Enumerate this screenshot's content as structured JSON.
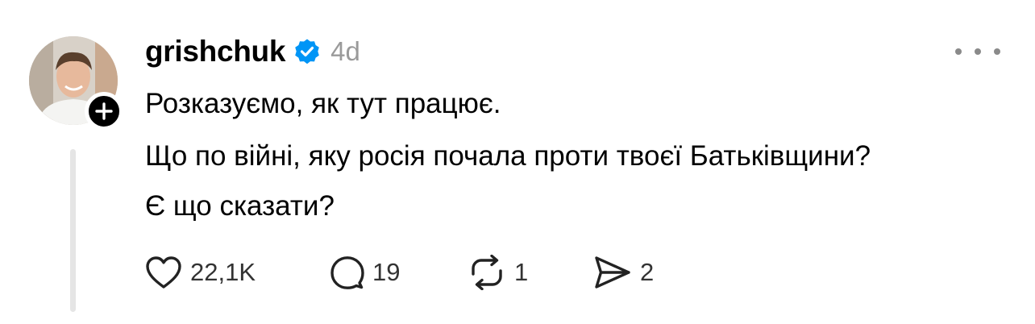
{
  "post": {
    "author": {
      "username": "grishchuk",
      "verified": true,
      "time_ago": "4d"
    },
    "text_lines": [
      "Розказуємо, як тут працює.",
      "Що по війні, яку росія почала проти твоєї Батьківщини?",
      "Є що сказати?"
    ],
    "actions": {
      "likes": "22,1K",
      "replies": "19",
      "reposts": "1",
      "shares": "2"
    }
  },
  "colors": {
    "verified_badge": "#0095f6",
    "muted_text": "#9a9a9a",
    "thread_line": "#e5e5e5"
  },
  "icons": [
    "plus-icon",
    "verified-badge-icon",
    "more-options-icon",
    "heart-icon",
    "comment-icon",
    "repost-icon",
    "share-icon"
  ]
}
